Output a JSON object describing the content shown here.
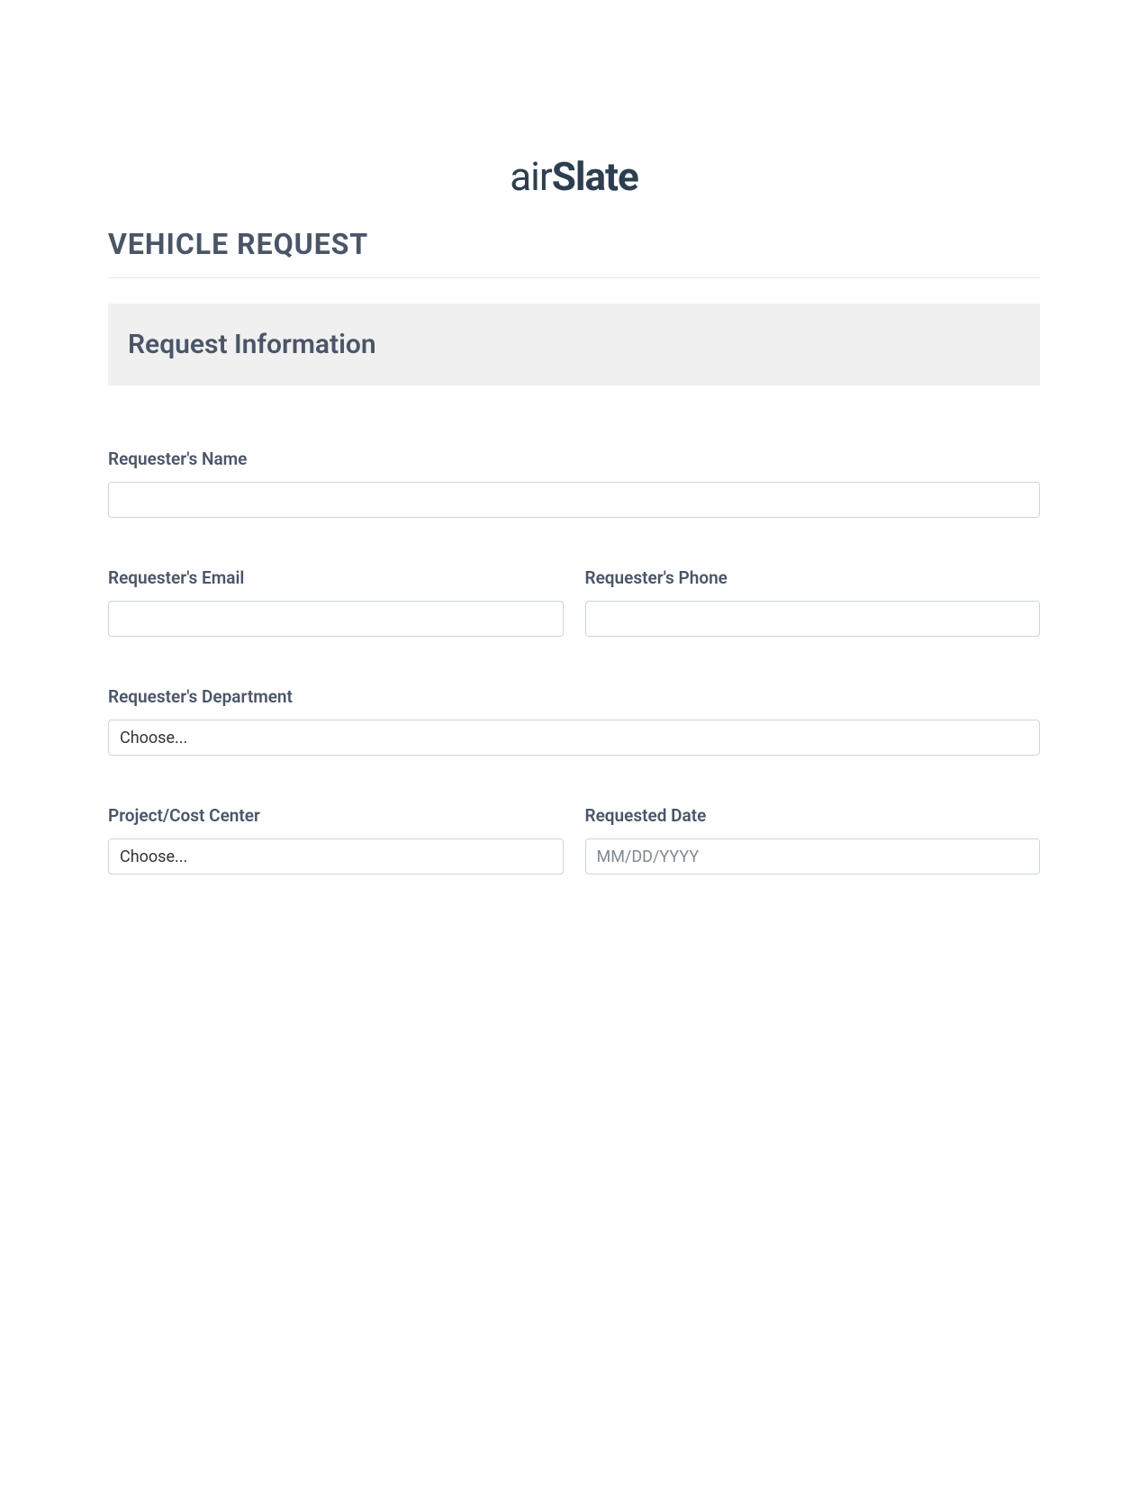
{
  "logo": {
    "part1": "air",
    "part2": "Slate"
  },
  "title": "VEHICLE REQUEST",
  "section": {
    "title": "Request Information"
  },
  "fields": {
    "name": {
      "label": "Requester's Name",
      "value": ""
    },
    "email": {
      "label": "Requester's Email",
      "value": ""
    },
    "phone": {
      "label": "Requester's Phone",
      "value": ""
    },
    "department": {
      "label": "Requester's Department",
      "selected": "Choose..."
    },
    "project": {
      "label": "Project/Cost Center",
      "selected": "Choose..."
    },
    "date": {
      "label": "Requested Date",
      "placeholder": "MM/DD/YYYY",
      "value": ""
    }
  }
}
